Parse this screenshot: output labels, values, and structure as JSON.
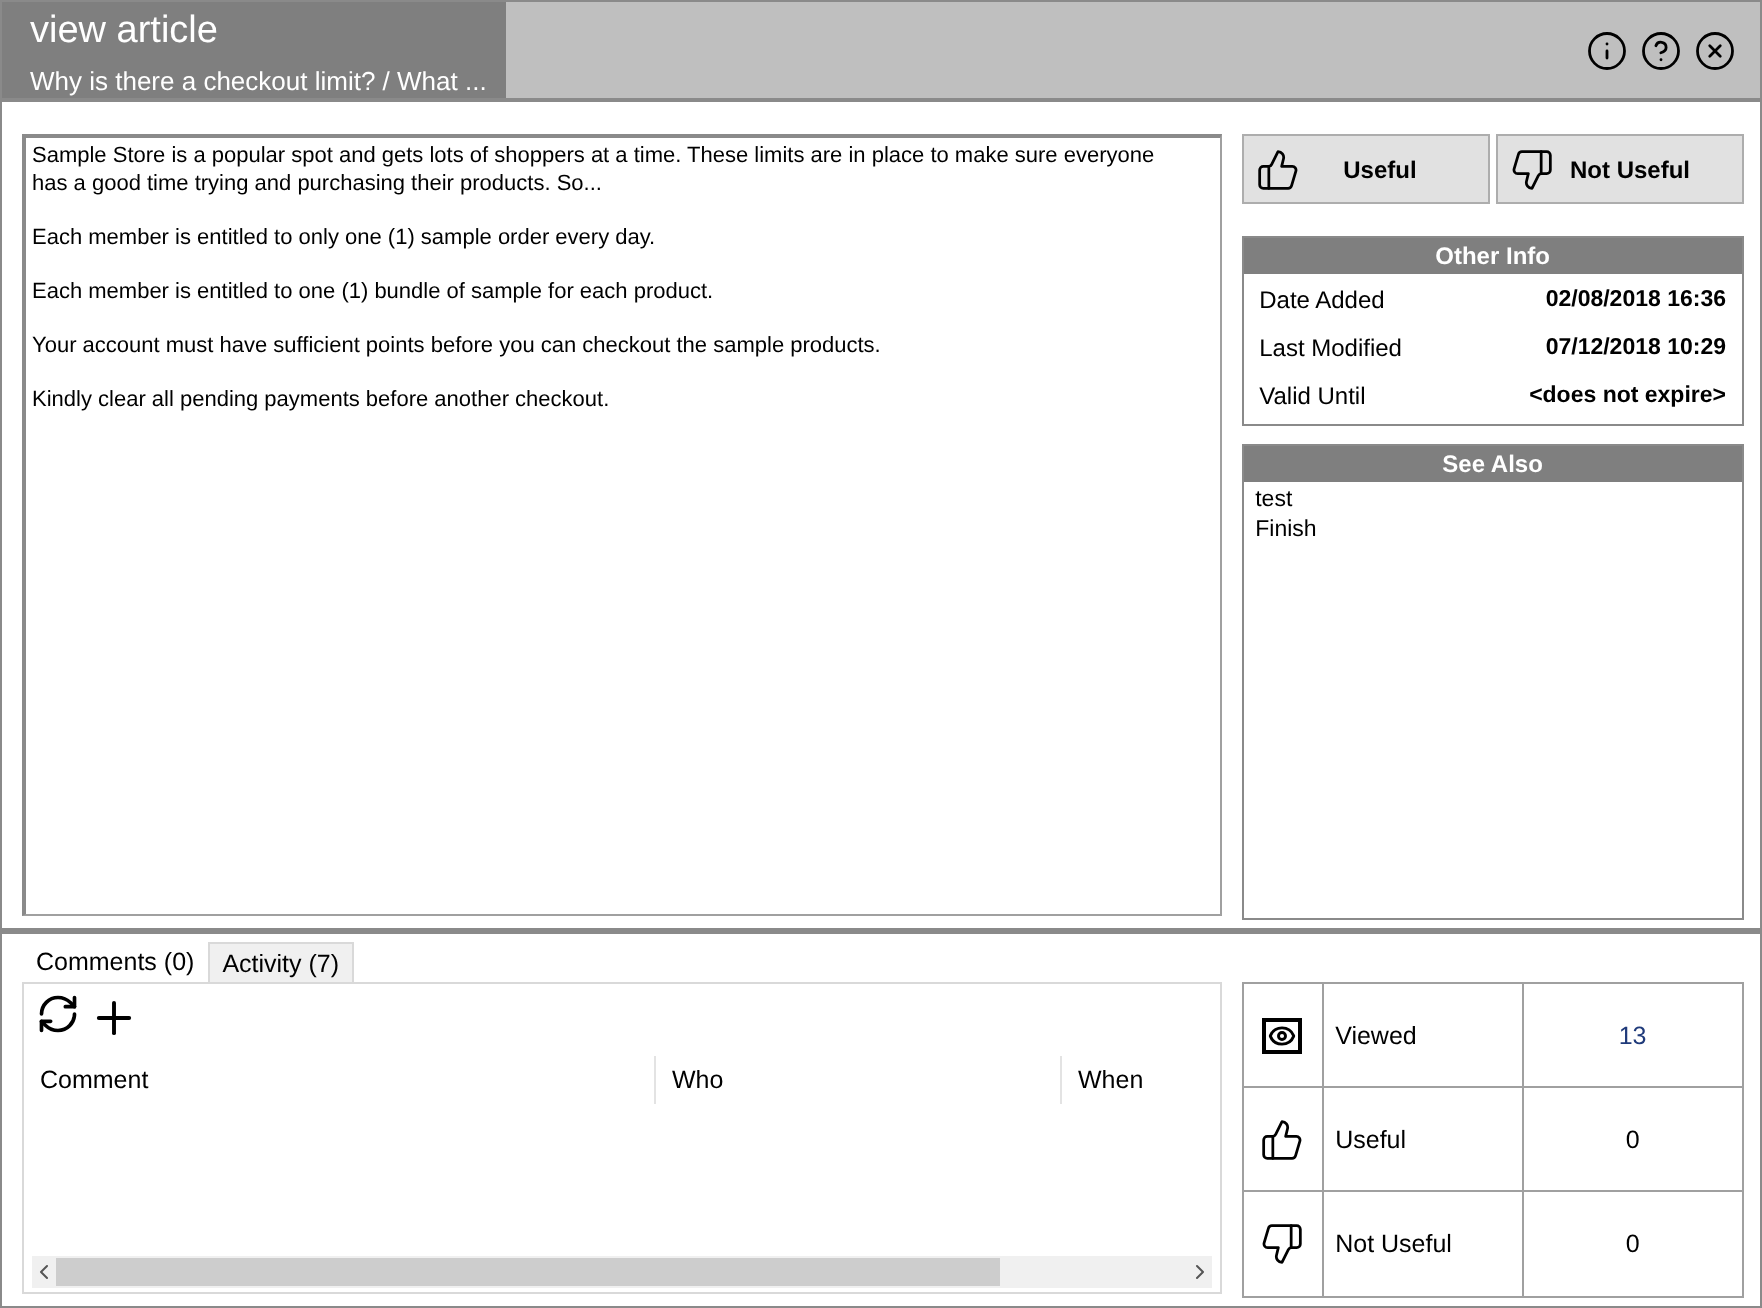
{
  "window": {
    "title": "view article",
    "subtitle": "Why is there a checkout limit? / What ..."
  },
  "title_buttons": [
    {
      "kind": "info"
    },
    {
      "kind": "help"
    },
    {
      "kind": "close"
    }
  ],
  "article": {
    "paragraphs": [
      "Sample Store is a popular spot and gets lots of shoppers at a time. These limits are in place to make sure everyone has a good time trying and purchasing their products. So...",
      "Each member is entitled to only one (1) sample order every day.",
      "Each member is entitled to one (1) bundle of sample for each product.",
      "Your account must have sufficient points before you can checkout the sample products.",
      "Kindly clear all pending payments before another checkout."
    ]
  },
  "vote_buttons": [
    {
      "kind": "up",
      "label": "Useful"
    },
    {
      "kind": "down",
      "label": "Not Useful"
    }
  ],
  "other_info": {
    "title": "Other Info",
    "rows": [
      {
        "label": "Date Added",
        "value": "02/08/2018 16:36"
      },
      {
        "label": "Last Modified",
        "value": "07/12/2018 10:29"
      },
      {
        "label": "Valid Until",
        "value": "<does not expire>"
      }
    ]
  },
  "see_also": {
    "title": "See Also",
    "items": [
      "test",
      "Finish"
    ]
  },
  "tabs": [
    {
      "label": "Comments (0)",
      "selected": true
    },
    {
      "label": "Activity (7)",
      "selected": false
    }
  ],
  "toolbar": [
    {
      "kind": "refresh"
    },
    {
      "kind": "add"
    }
  ],
  "table": {
    "columns": [
      "Comment",
      "Who",
      "When"
    ]
  },
  "stats": [
    {
      "kind": "viewed",
      "label": "Viewed",
      "value": "13"
    },
    {
      "kind": "up",
      "label": "Useful",
      "value": "0"
    },
    {
      "kind": "down",
      "label": "Not Useful",
      "value": "0"
    }
  ]
}
